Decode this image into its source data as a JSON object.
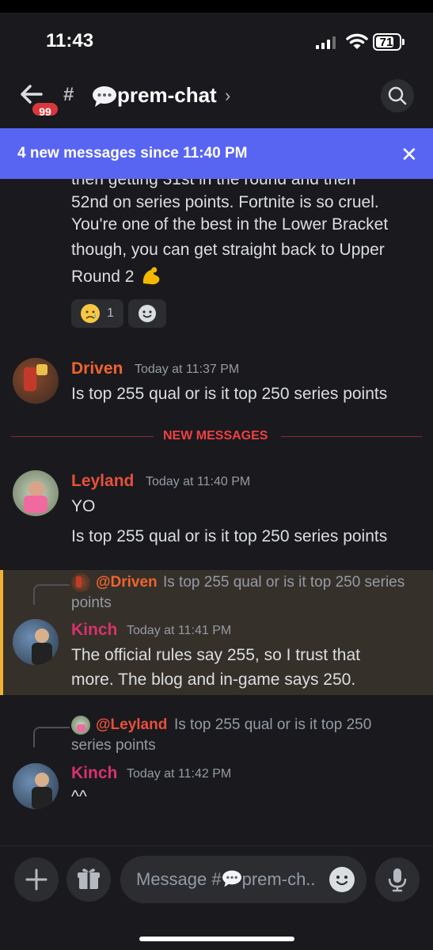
{
  "status_bar": {
    "time": "11:43",
    "battery": "71"
  },
  "header": {
    "badge": "99",
    "hash": "#",
    "channel": "prem-chat",
    "chevron": "›"
  },
  "banner": {
    "text": "4 new messages since 11:40 PM",
    "close": "✕"
  },
  "prev_message": {
    "lines": [
      "then getting 31st in the round and then",
      "52nd on series points. Fortnite is so cruel.",
      "You're one of the best in the Lower Bracket",
      "though, you can get straight back to Upper",
      "Round 2"
    ],
    "reaction_count": "1"
  },
  "messages": [
    {
      "author": "Driven",
      "time": "Today at 11:37 PM",
      "text": [
        "Is top 255 qual or is it top 250 series points"
      ],
      "color": "#f0642d"
    },
    {
      "author": "Leyland",
      "time": "Today at 11:40 PM",
      "text": [
        "YO",
        "Is top 255 qual or is it top 250 series points"
      ],
      "color": "#e8503a"
    },
    {
      "author": "Kinch",
      "time": "Today at 11:41 PM",
      "text": [
        "The official rules say 255, so I trust that",
        "more. The blog and in-game says 250."
      ],
      "color": "#d6336c",
      "reply": {
        "to": "@Driven",
        "text_line1": "Is top 255 qual or is it top 250 series",
        "text_line2": "points",
        "color": "#f0642d"
      }
    },
    {
      "author": "Kinch",
      "time": "Today at 11:42 PM",
      "text": [
        "^^"
      ],
      "color": "#d6336c",
      "reply": {
        "to": "@Leyland",
        "text_line1": "Is top 255 qual or is it top 250",
        "text_line2": "series points",
        "color": "#e8503a"
      }
    }
  ],
  "divider": {
    "label": "NEW MESSAGES",
    "color": "#f23f43"
  },
  "composer": {
    "placeholder": "Message #",
    "channel": "prem-ch.."
  },
  "colors": {
    "accent": "#5865f2",
    "highlight_border": "#f0b232",
    "background": "#1a1a1e"
  }
}
